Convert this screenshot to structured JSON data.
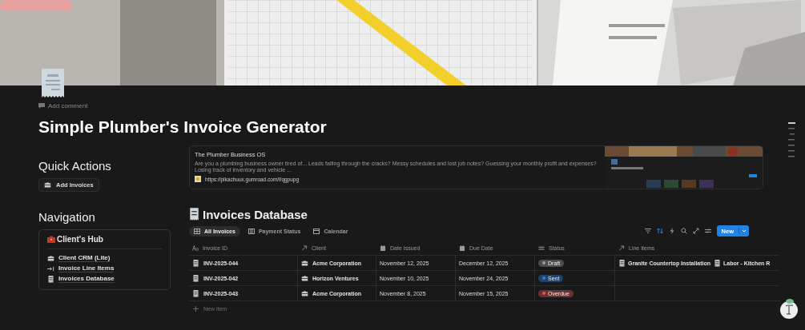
{
  "page": {
    "add_comment": "Add comment",
    "title": "Simple Plumber's Invoice Generator"
  },
  "quick_actions": {
    "heading": "Quick Actions",
    "buttons": [
      "Add Invoices"
    ]
  },
  "navigation": {
    "heading": "Navigation",
    "card_title": "Client's Hub",
    "items": [
      "Client CRM (Lite)",
      "Invoice Line Items",
      "Invoices Database"
    ]
  },
  "bookmark": {
    "title": "The Plumber Business OS",
    "description": "Are you a plumbing business owner tired of... Leads falling through the cracks? Messy schedules and lost job notes? Guessing your monthly profit and expenses? Losing track of inventory and vehicle ...",
    "url": "https://pikachuux.gumroad.com/l/qgpupg"
  },
  "database": {
    "title": "Invoices Database",
    "tabs": [
      {
        "label": "All Invoices",
        "selected": true
      },
      {
        "label": "Payment Status",
        "selected": false
      },
      {
        "label": "Calendar",
        "selected": false
      }
    ],
    "new_button": "New",
    "columns": [
      "Invoice ID",
      "Client",
      "Date Issued",
      "Due Date",
      "Status",
      "Line Items"
    ],
    "rows": [
      {
        "invoice_id": "INV-2025-044",
        "client": "Acme Corporation",
        "date_issued": "November 12, 2025",
        "due_date": "December 12, 2025",
        "status": {
          "label": "Draft",
          "color": "#9b9a97"
        },
        "line_items": [
          "Granite Countertop Installation",
          "Labor - Kitchen R"
        ]
      },
      {
        "invoice_id": "INV-2025-042",
        "client": "Horizon Ventures",
        "date_issued": "November 10, 2025",
        "due_date": "November 24, 2025",
        "status": {
          "label": "Sent",
          "color": "#2e7fd9"
        },
        "line_items": []
      },
      {
        "invoice_id": "INV-2025-043",
        "client": "Acme Corporation",
        "date_issued": "November 8, 2025",
        "due_date": "November 15, 2025",
        "status": {
          "label": "Overdue",
          "color": "#e0584f"
        },
        "line_items": []
      }
    ],
    "new_item": "New item"
  }
}
